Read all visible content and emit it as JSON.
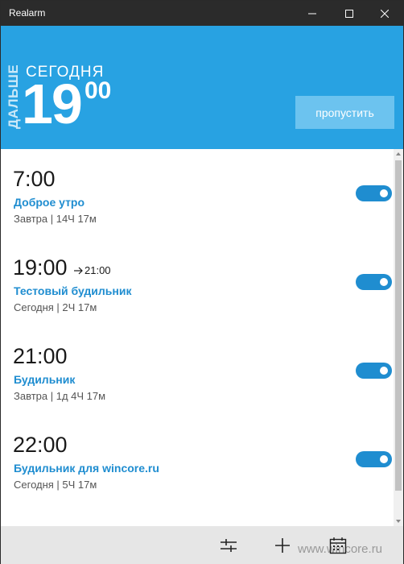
{
  "window": {
    "title": "Realarm"
  },
  "header": {
    "next_label": "ДАЛЬШЕ",
    "day_label": "СЕГОДНЯ",
    "time_hours": "19",
    "time_minutes": "00",
    "skip_label": "пропустить"
  },
  "alarms": [
    {
      "time": "7:00",
      "arrow_time": "",
      "name": "Доброе утро",
      "subtitle": "Завтра | 14Ч 17м",
      "enabled": true
    },
    {
      "time": "19:00",
      "arrow_time": "21:00",
      "name": "Тестовый будильник",
      "subtitle": "Сегодня | 2Ч 17м",
      "enabled": true
    },
    {
      "time": "21:00",
      "arrow_time": "",
      "name": "Будильник",
      "subtitle": "Завтра | 1д 4Ч 17м",
      "enabled": true
    },
    {
      "time": "22:00",
      "arrow_time": "",
      "name": "Будильник для wincore.ru",
      "subtitle": "Сегодня | 5Ч 17м",
      "enabled": true
    }
  ],
  "appbar": {
    "icons": [
      "settings-sliders-icon",
      "add-icon",
      "calendar-icon"
    ],
    "watermark": "www.wincore.ru"
  },
  "colors": {
    "accent": "#28a2e2",
    "alarm_name": "#1f8dd0",
    "toggle_on": "#1f8dd0",
    "titlebar": "#2b2b2b"
  }
}
